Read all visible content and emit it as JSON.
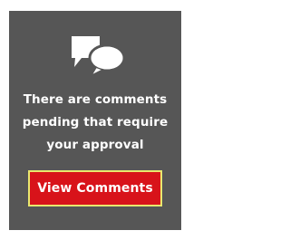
{
  "notice": {
    "icon": "comments-icon",
    "message_lines": [
      "There are comments",
      "pending that require",
      "your approval"
    ],
    "button_label": "View Comments"
  },
  "colors": {
    "panel_background": "#565656",
    "text": "#ffffff",
    "button_background": "#d8131a",
    "button_border": "#e9e86e"
  }
}
